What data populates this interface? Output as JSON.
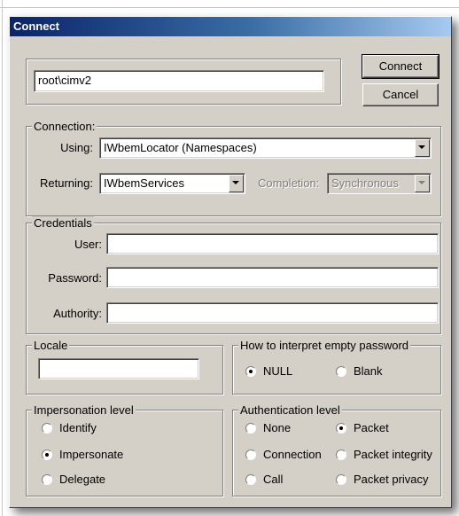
{
  "window": {
    "title": "Connect"
  },
  "namespace": {
    "value": "root\\cimv2"
  },
  "buttons": {
    "connect": "Connect",
    "cancel": "Cancel"
  },
  "connection": {
    "legend": "Connection:",
    "using_label": "Using:",
    "using_value": "IWbemLocator (Namespaces)",
    "returning_label": "Returning:",
    "returning_value": "IWbemServices",
    "completion_label": "Completion:",
    "completion_value": "Synchronous"
  },
  "credentials": {
    "legend": "Credentials",
    "user_label": "User:",
    "user_value": "",
    "password_label": "Password:",
    "password_value": "",
    "authority_label": "Authority:",
    "authority_value": ""
  },
  "locale": {
    "legend": "Locale",
    "value": ""
  },
  "empty_password": {
    "legend": "How to interpret empty password",
    "options": [
      "NULL",
      "Blank"
    ],
    "selected": "NULL"
  },
  "impersonation": {
    "legend": "Impersonation level",
    "options": [
      "Identify",
      "Impersonate",
      "Delegate"
    ],
    "selected": "Impersonate"
  },
  "authentication": {
    "legend": "Authentication level",
    "options": [
      "None",
      "Packet",
      "Connection",
      "Packet integrity",
      "Call",
      "Packet privacy"
    ],
    "selected": "Packet"
  }
}
